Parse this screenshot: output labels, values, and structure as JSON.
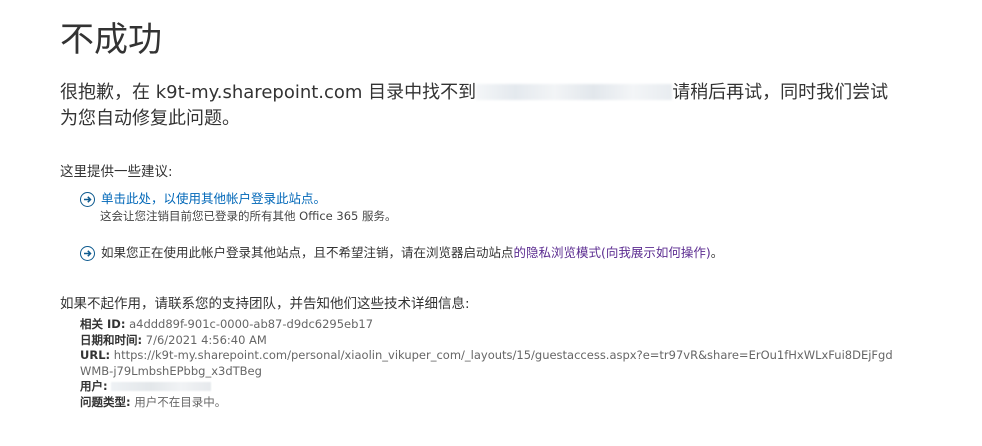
{
  "page": {
    "title": "不成功"
  },
  "message": {
    "prefix": "很抱歉，在 k9t-my.sharepoint.com 目录中找不到",
    "suffix": "请稍后再试，同时我们尝试为您自动修复此问题。"
  },
  "suggestions": {
    "heading": "这里提供一些建议:",
    "items": [
      {
        "link_text": "单击此处，以使用其他帐户登录此站点。",
        "note": "这会让您注销目前您已登录的所有其他 Office 365 服务。"
      },
      {
        "text_before": "如果您正在使用此帐户登录其他站点，且不希望注销，请在浏览器启动站点",
        "link_text": "的隐私浏览模式(向我展示如何操作)",
        "text_after": "。"
      }
    ]
  },
  "contact": {
    "heading": "如果不起作用，请联系您的支持团队，并告知他们这些技术详细信息:"
  },
  "details": {
    "correlation_label": "相关 ID:",
    "correlation_value": "a4ddd89f-901c-0000-ab87-d9dc6295eb17",
    "datetime_label": "日期和时间:",
    "datetime_value": "7/6/2021 4:56:40 AM",
    "url_label": "URL:",
    "url_value": "https://k9t-my.sharepoint.com/personal/xiaolin_vikuper_com/_layouts/15/guestaccess.aspx?e=tr97vR&share=ErOu1fHxWLxFui8DEjFgdWMB-j79LmbshEPbbg_x3dTBeg",
    "user_label": "用户:",
    "issue_label": "问题类型:",
    "issue_value": "用户不在目录中。"
  },
  "colors": {
    "link": "#0067b8",
    "visited_link": "#5c2d91",
    "text": "#333333"
  },
  "icons": {
    "suggestion_icon": "circle-arrow-right-icon"
  }
}
